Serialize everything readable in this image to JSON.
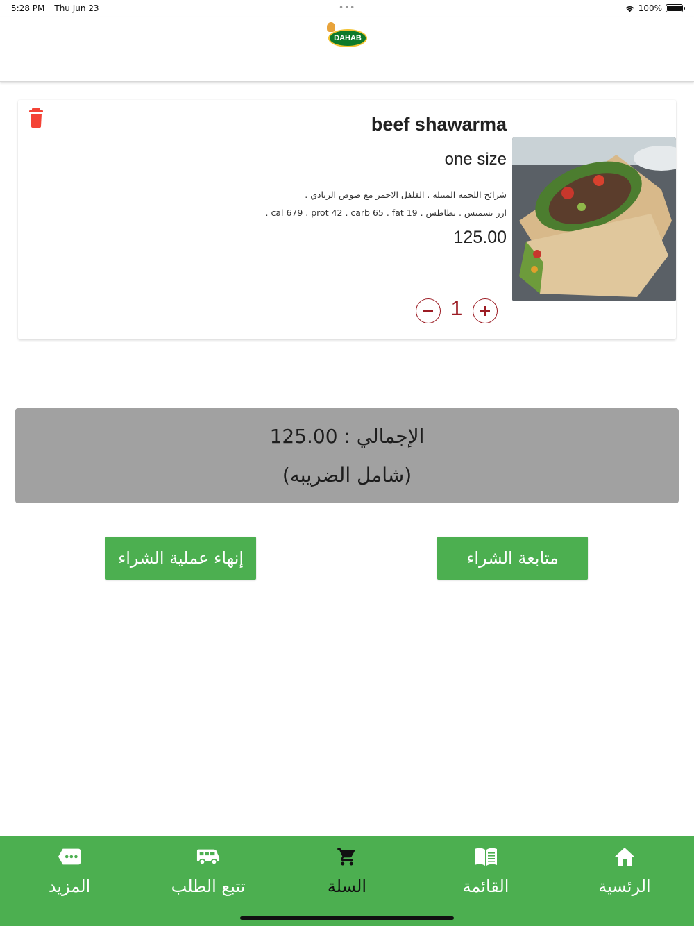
{
  "status_bar": {
    "time": "5:28 PM",
    "date": "Thu Jun 23",
    "battery": "100%"
  },
  "header": {
    "logo_text": "DAHAB"
  },
  "cart": {
    "items": [
      {
        "name": "beef shawarma",
        "size": "one size",
        "description_line1": "شرائح اللحمه المتبله . الفلفل الاحمر مع صوص الزبادي .",
        "description_line2": "ارز بسمتس . بطاطس . cal 679 . prot 42 . carb 65 . fat 19 .",
        "price": "125.00",
        "quantity": "1"
      }
    ]
  },
  "summary": {
    "total_text": "الإجمالي : 125.00",
    "tax_note": "(شامل الضريبه)"
  },
  "actions": {
    "finish_label": "إنهاء عملية الشراء",
    "continue_label": "متابعة الشراء"
  },
  "bottom_nav": {
    "items": [
      {
        "label": "المزيد",
        "icon": "more-icon"
      },
      {
        "label": "تتبع الطلب",
        "icon": "delivery-van-icon"
      },
      {
        "label": "السلة",
        "icon": "cart-icon"
      },
      {
        "label": "القائمة",
        "icon": "menu-book-icon"
      },
      {
        "label": "الرئسية",
        "icon": "home-icon"
      }
    ]
  },
  "colors": {
    "accent_green": "#4caf50",
    "quantity_red": "#9c1c24",
    "delete_red": "#f44336",
    "total_bg": "#a1a1a1"
  }
}
